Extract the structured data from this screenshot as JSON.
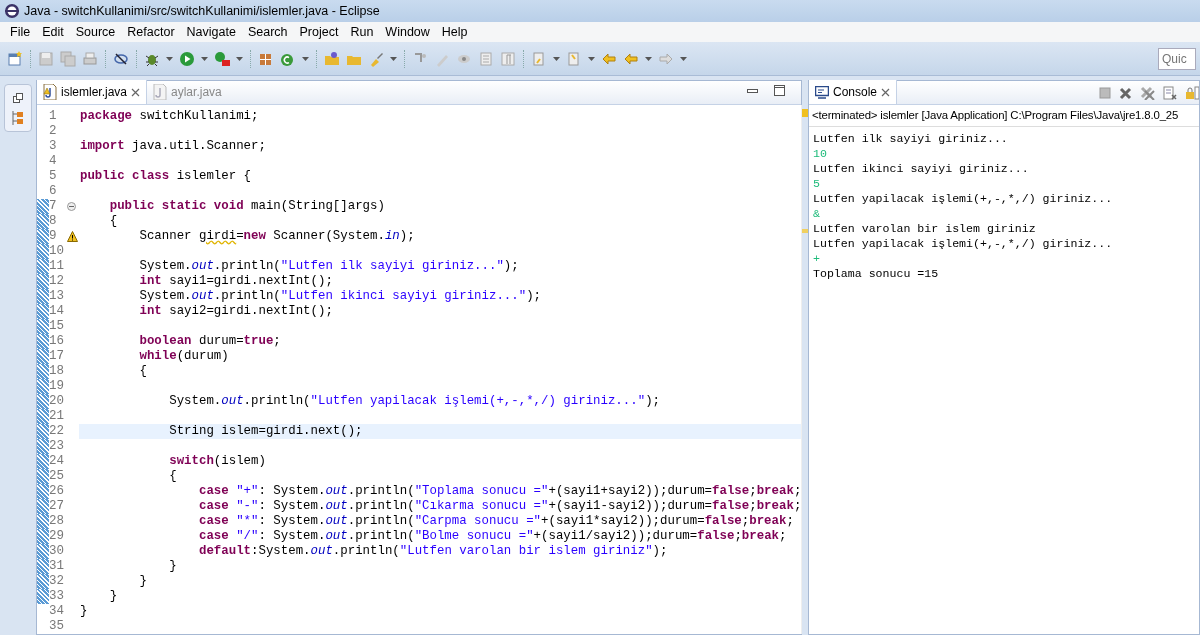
{
  "window": {
    "title": "Java - switchKullanimi/src/switchKullanimi/islemler.java - Eclipse"
  },
  "menu": [
    "File",
    "Edit",
    "Source",
    "Refactor",
    "Navigate",
    "Search",
    "Project",
    "Run",
    "Window",
    "Help"
  ],
  "quick_access": {
    "placeholder": "Quic"
  },
  "editor": {
    "tabs": [
      {
        "label": "islemler.java",
        "selected": true
      },
      {
        "label": "aylar.java",
        "selected": false
      }
    ],
    "lines": [
      {
        "number": "1",
        "changed": false,
        "current": false,
        "tokens": [
          {
            "kind": "kw",
            "text": "package"
          },
          {
            "kind": "plain",
            "text": " switchKullanimi;"
          }
        ]
      },
      {
        "number": "2",
        "changed": false,
        "current": false
      },
      {
        "number": "3",
        "changed": false,
        "current": false,
        "tokens": [
          {
            "kind": "kw",
            "text": "import"
          },
          {
            "kind": "plain",
            "text": " java.util.Scanner;"
          }
        ]
      },
      {
        "number": "4",
        "changed": false,
        "current": false
      },
      {
        "number": "5",
        "changed": false,
        "current": false,
        "tokens": [
          {
            "kind": "kw",
            "text": "public "
          },
          {
            "kind": "kw",
            "text": "class"
          },
          {
            "kind": "plain",
            "text": " islemler {"
          }
        ]
      },
      {
        "number": "6",
        "changed": false,
        "current": false
      },
      {
        "number": "7",
        "changed": true,
        "current": false,
        "kind": "fold",
        "tokens": [
          {
            "kind": "kw",
            "text": "    public "
          },
          {
            "kind": "kw",
            "text": "static "
          },
          {
            "kind": "kw",
            "text": "void"
          },
          {
            "kind": "plain",
            "text": " main(String[]args)"
          }
        ]
      },
      {
        "number": "8",
        "changed": true,
        "current": false,
        "tokens": [
          {
            "kind": "plain",
            "text": "    {"
          }
        ]
      },
      {
        "number": "9",
        "changed": true,
        "current": false,
        "kind": "warning",
        "tokens": [
          {
            "kind": "plain",
            "text": "        Scanner "
          },
          {
            "kind": "warn",
            "text": "girdi"
          },
          {
            "kind": "plain",
            "text": "="
          },
          {
            "kind": "kw",
            "text": "new"
          },
          {
            "kind": "plain",
            "text": " Scanner(System."
          },
          {
            "kind": "field",
            "text": "in"
          },
          {
            "kind": "plain",
            "text": ");"
          }
        ]
      },
      {
        "number": "10",
        "changed": true,
        "current": false
      },
      {
        "number": "11",
        "changed": true,
        "current": false,
        "tokens": [
          {
            "kind": "plain",
            "text": "        System."
          },
          {
            "kind": "field",
            "text": "out"
          },
          {
            "kind": "plain",
            "text": ".println("
          },
          {
            "kind": "str",
            "text": "\"Lutfen ilk sayiyi giriniz...\""
          },
          {
            "kind": "plain",
            "text": ");"
          }
        ]
      },
      {
        "number": "12",
        "changed": true,
        "current": false,
        "tokens": [
          {
            "kind": "kw",
            "text": "        int"
          },
          {
            "kind": "plain",
            "text": " sayi1=girdi.nextInt();"
          }
        ]
      },
      {
        "number": "13",
        "changed": true,
        "current": false,
        "tokens": [
          {
            "kind": "plain",
            "text": "        System."
          },
          {
            "kind": "field",
            "text": "out"
          },
          {
            "kind": "plain",
            "text": ".println("
          },
          {
            "kind": "str",
            "text": "\"Lutfen ikinci sayiyi giriniz...\""
          },
          {
            "kind": "plain",
            "text": ");"
          }
        ]
      },
      {
        "number": "14",
        "changed": true,
        "current": false,
        "tokens": [
          {
            "kind": "kw",
            "text": "        int"
          },
          {
            "kind": "plain",
            "text": " sayi2=girdi.nextInt();"
          }
        ]
      },
      {
        "number": "15",
        "changed": true,
        "current": false
      },
      {
        "number": "16",
        "changed": true,
        "current": false,
        "tokens": [
          {
            "kind": "kw",
            "text": "        boolean"
          },
          {
            "kind": "plain",
            "text": " durum="
          },
          {
            "kind": "kw",
            "text": "true"
          },
          {
            "kind": "plain",
            "text": ";"
          }
        ]
      },
      {
        "number": "17",
        "changed": true,
        "current": false,
        "tokens": [
          {
            "kind": "kw",
            "text": "        while"
          },
          {
            "kind": "plain",
            "text": "(durum)"
          }
        ]
      },
      {
        "number": "18",
        "changed": true,
        "current": false,
        "tokens": [
          {
            "kind": "plain",
            "text": "        {"
          }
        ]
      },
      {
        "number": "19",
        "changed": true,
        "current": false
      },
      {
        "number": "20",
        "changed": true,
        "current": false,
        "tokens": [
          {
            "kind": "plain",
            "text": "            System."
          },
          {
            "kind": "field",
            "text": "out"
          },
          {
            "kind": "plain",
            "text": ".println("
          },
          {
            "kind": "str",
            "text": "\"Lutfen yapilacak işlemi(+,-,*,/) giriniz...\""
          },
          {
            "kind": "plain",
            "text": ");"
          }
        ]
      },
      {
        "number": "21",
        "changed": true,
        "current": false
      },
      {
        "number": "22",
        "changed": true,
        "current": true,
        "tokens": [
          {
            "kind": "plain",
            "text": "            String islem=girdi.next();"
          }
        ]
      },
      {
        "number": "23",
        "changed": true,
        "current": false
      },
      {
        "number": "24",
        "changed": true,
        "current": false,
        "tokens": [
          {
            "kind": "kw",
            "text": "            switch"
          },
          {
            "kind": "plain",
            "text": "(islem)"
          }
        ]
      },
      {
        "number": "25",
        "changed": true,
        "current": false,
        "tokens": [
          {
            "kind": "plain",
            "text": "            {"
          }
        ]
      },
      {
        "number": "26",
        "changed": true,
        "current": false,
        "tokens": [
          {
            "kind": "kw",
            "text": "                case "
          },
          {
            "kind": "str",
            "text": "\"+\""
          },
          {
            "kind": "plain",
            "text": ": System."
          },
          {
            "kind": "field",
            "text": "out"
          },
          {
            "kind": "plain",
            "text": ".println("
          },
          {
            "kind": "str",
            "text": "\"Toplama sonucu =\""
          },
          {
            "kind": "plain",
            "text": "+(sayi1+sayi2));durum="
          },
          {
            "kind": "kw",
            "text": "false"
          },
          {
            "kind": "plain",
            "text": ";"
          },
          {
            "kind": "kw",
            "text": "break"
          },
          {
            "kind": "plain",
            "text": ";"
          }
        ]
      },
      {
        "number": "27",
        "changed": true,
        "current": false,
        "tokens": [
          {
            "kind": "kw",
            "text": "                case "
          },
          {
            "kind": "str",
            "text": "\"-\""
          },
          {
            "kind": "plain",
            "text": ": System."
          },
          {
            "kind": "field",
            "text": "out"
          },
          {
            "kind": "plain",
            "text": ".println("
          },
          {
            "kind": "str",
            "text": "\"Cıkarma sonucu =\""
          },
          {
            "kind": "plain",
            "text": "+(sayi1-sayi2));durum="
          },
          {
            "kind": "kw",
            "text": "false"
          },
          {
            "kind": "plain",
            "text": ";"
          },
          {
            "kind": "kw",
            "text": "break"
          },
          {
            "kind": "plain",
            "text": ";"
          }
        ]
      },
      {
        "number": "28",
        "changed": true,
        "current": false,
        "tokens": [
          {
            "kind": "kw",
            "text": "                case "
          },
          {
            "kind": "str",
            "text": "\"*\""
          },
          {
            "kind": "plain",
            "text": ": System."
          },
          {
            "kind": "field",
            "text": "out"
          },
          {
            "kind": "plain",
            "text": ".println("
          },
          {
            "kind": "str",
            "text": "\"Carpma sonucu =\""
          },
          {
            "kind": "plain",
            "text": "+(sayi1*sayi2));durum="
          },
          {
            "kind": "kw",
            "text": "false"
          },
          {
            "kind": "plain",
            "text": ";"
          },
          {
            "kind": "kw",
            "text": "break"
          },
          {
            "kind": "plain",
            "text": ";"
          }
        ]
      },
      {
        "number": "29",
        "changed": true,
        "current": false,
        "tokens": [
          {
            "kind": "kw",
            "text": "                case "
          },
          {
            "kind": "str",
            "text": "\"/\""
          },
          {
            "kind": "plain",
            "text": ": System."
          },
          {
            "kind": "field",
            "text": "out"
          },
          {
            "kind": "plain",
            "text": ".println("
          },
          {
            "kind": "str",
            "text": "\"Bolme sonucu =\""
          },
          {
            "kind": "plain",
            "text": "+(sayi1/sayi2));durum="
          },
          {
            "kind": "kw",
            "text": "false"
          },
          {
            "kind": "plain",
            "text": ";"
          },
          {
            "kind": "kw",
            "text": "break"
          },
          {
            "kind": "plain",
            "text": ";"
          }
        ]
      },
      {
        "number": "30",
        "changed": true,
        "current": false,
        "tokens": [
          {
            "kind": "kw",
            "text": "                default"
          },
          {
            "kind": "plain",
            "text": ":System."
          },
          {
            "kind": "field",
            "text": "out"
          },
          {
            "kind": "plain",
            "text": ".println("
          },
          {
            "kind": "str",
            "text": "\"Lutfen varolan bir islem giriniz\""
          },
          {
            "kind": "plain",
            "text": ");"
          }
        ]
      },
      {
        "number": "31",
        "changed": true,
        "current": false,
        "tokens": [
          {
            "kind": "plain",
            "text": "            }"
          }
        ]
      },
      {
        "number": "32",
        "changed": true,
        "current": false,
        "tokens": [
          {
            "kind": "plain",
            "text": "        }"
          }
        ]
      },
      {
        "number": "33",
        "changed": true,
        "current": false,
        "tokens": [
          {
            "kind": "plain",
            "text": "    }"
          }
        ]
      },
      {
        "number": "34",
        "changed": false,
        "current": false,
        "tokens": [
          {
            "kind": "plain",
            "text": "}"
          }
        ]
      },
      {
        "number": "35",
        "changed": false,
        "current": false
      }
    ]
  },
  "console": {
    "tab": {
      "label": "Console",
      "selected": true
    },
    "header": "<terminated> islemler [Java Application] C:\\Program Files\\Java\\jre1.8.0_25",
    "lines": [
      {
        "kind": "output",
        "text": "Lutfen ilk sayiyi giriniz..."
      },
      {
        "kind": "input",
        "text": "10"
      },
      {
        "kind": "output",
        "text": "Lutfen ikinci sayiyi giriniz..."
      },
      {
        "kind": "input",
        "text": "5"
      },
      {
        "kind": "output",
        "text": "Lutfen yapilacak işlemi(+,-,*,/) giriniz..."
      },
      {
        "kind": "input",
        "text": "&"
      },
      {
        "kind": "output",
        "text": "Lutfen varolan bir islem giriniz"
      },
      {
        "kind": "output",
        "text": "Lutfen yapilacak işlemi(+,-,*,/) giriniz..."
      },
      {
        "kind": "input",
        "text": "+"
      },
      {
        "kind": "output",
        "text": "Toplama sonucu =15"
      }
    ]
  }
}
